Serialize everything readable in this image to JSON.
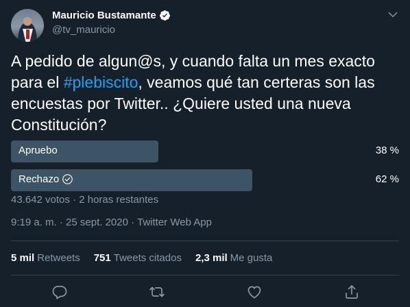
{
  "author": {
    "name": "Mauricio Bustamante",
    "handle": "@tv_mauricio"
  },
  "tweet": {
    "text_before": "A pedido de algun@s, y cuando falta un mes exacto para el ",
    "hashtag": "#plebiscito",
    "text_after": ", veamos qué tan certeras son las encuestas por Twitter.. ¿Quiere usted una nueva Constitución?"
  },
  "poll": {
    "options": [
      {
        "label": "Apruebo",
        "percent_text": "38 %",
        "fraction": 0.38,
        "selected": false
      },
      {
        "label": "Rechazo",
        "percent_text": "62 %",
        "fraction": 0.62,
        "selected": true
      }
    ],
    "meta": "43.642 votos · 2 horas restantes"
  },
  "timestamp": "9:19 a. m. · 25 sept. 2020 · Twitter Web App",
  "stats": {
    "retweets_count": "5 mil",
    "retweets_label": "Retweets",
    "quotes_count": "751",
    "quotes_label": "Tweets citados",
    "likes_count": "2,3 mil",
    "likes_label": "Me gusta"
  },
  "icons": [
    "verified-badge-icon",
    "chevron-down-icon",
    "check-circle-icon",
    "reply-icon",
    "retweet-icon",
    "like-icon",
    "share-icon"
  ],
  "colors": {
    "background": "#15202b",
    "accent": "#1da1f2",
    "secondary_text": "#8899a6",
    "poll_bar": "#3d5466"
  }
}
